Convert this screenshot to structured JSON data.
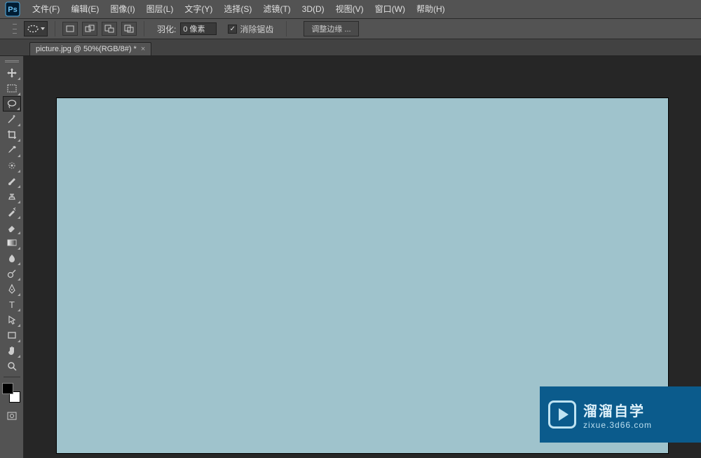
{
  "menubar": {
    "items": [
      "文件(F)",
      "编辑(E)",
      "图像(I)",
      "图层(L)",
      "文字(Y)",
      "选择(S)",
      "滤镜(T)",
      "3D(D)",
      "视图(V)",
      "窗口(W)",
      "帮助(H)"
    ]
  },
  "option_bar": {
    "feather_label": "羽化:",
    "feather_value": "0 像素",
    "antialias_label": "消除锯齿",
    "adjust_edge_label": "调整边缘 ..."
  },
  "document_tab": {
    "title": "picture.jpg @ 50%(RGB/8#) *"
  },
  "tools": [
    {
      "name": "move-tool"
    },
    {
      "name": "rectangular-marquee-tool"
    },
    {
      "name": "lasso-tool",
      "active": true
    },
    {
      "name": "magic-wand-tool"
    },
    {
      "name": "crop-tool"
    },
    {
      "name": "eyedropper-tool"
    },
    {
      "name": "spot-healing-brush-tool"
    },
    {
      "name": "brush-tool"
    },
    {
      "name": "clone-stamp-tool"
    },
    {
      "name": "history-brush-tool"
    },
    {
      "name": "eraser-tool"
    },
    {
      "name": "gradient-tool"
    },
    {
      "name": "blur-tool"
    },
    {
      "name": "dodge-tool"
    },
    {
      "name": "pen-tool"
    },
    {
      "name": "horizontal-type-tool"
    },
    {
      "name": "path-selection-tool"
    },
    {
      "name": "rectangle-tool"
    },
    {
      "name": "hand-tool"
    },
    {
      "name": "zoom-tool"
    }
  ],
  "canvas": {
    "color": "#9fc3cc"
  },
  "watermark": {
    "title": "溜溜自学",
    "url": "zixue.3d66.com"
  }
}
